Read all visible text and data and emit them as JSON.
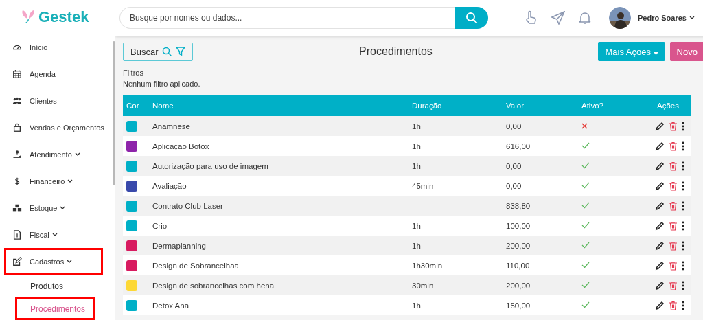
{
  "brand": {
    "name": "Gestek"
  },
  "sidebar": {
    "items": [
      {
        "label": "Início",
        "has_caret": false,
        "highlighted": false
      },
      {
        "label": "Agenda",
        "has_caret": false,
        "highlighted": false
      },
      {
        "label": "Clientes",
        "has_caret": false,
        "highlighted": false
      },
      {
        "label": "Vendas e Orçamentos",
        "has_caret": false,
        "highlighted": false
      },
      {
        "label": "Atendimento",
        "has_caret": true,
        "highlighted": false
      },
      {
        "label": "Financeiro",
        "has_caret": true,
        "highlighted": false
      },
      {
        "label": "Estoque",
        "has_caret": true,
        "highlighted": false
      },
      {
        "label": "Fiscal",
        "has_caret": true,
        "highlighted": false
      },
      {
        "label": "Cadastros",
        "has_caret": true,
        "highlighted": true,
        "children": [
          {
            "label": "Produtos",
            "selected": false,
            "highlighted": false
          },
          {
            "label": "Procedimentos",
            "selected": true,
            "highlighted": true
          }
        ]
      }
    ]
  },
  "header": {
    "search": {
      "placeholder": "Busque por nomes ou dados..."
    },
    "user": {
      "name": "Pedro Soares"
    }
  },
  "toolbar": {
    "search_button": "Buscar",
    "title": "Procedimentos",
    "more_button": "Mais Ações",
    "new_button": "Novo"
  },
  "filters": {
    "label": "Filtros",
    "status": "Nenhum filtro aplicado."
  },
  "table": {
    "columns": [
      "Cor",
      "Nome",
      "Duração",
      "Valor",
      "Ativo?",
      "Ações"
    ],
    "rows": [
      {
        "color": "#00b0c7",
        "name": "Anamnese",
        "duration": "1h",
        "value": "0,00",
        "active": false
      },
      {
        "color": "#8e24aa",
        "name": "Aplicação Botox",
        "duration": "1h",
        "value": "616,00",
        "active": true
      },
      {
        "color": "#00b0c7",
        "name": "Autorização para uso de imagem",
        "duration": "1h",
        "value": "0,00",
        "active": true
      },
      {
        "color": "#3949ab",
        "name": "Avaliação",
        "duration": "45min",
        "value": "0,00",
        "active": true
      },
      {
        "color": "#00b0c7",
        "name": "Contrato Club Laser",
        "value": "838,80",
        "active": true
      },
      {
        "color": "#00b0c7",
        "name": "Crio",
        "duration": "1h",
        "value": "100,00",
        "active": true
      },
      {
        "color": "#d81b60",
        "name": "Dermaplanning",
        "duration": "1h",
        "value": "200,00",
        "active": true
      },
      {
        "color": "#d81b60",
        "name": "Design de Sobrancelhaa",
        "duration": "1h30min",
        "value": "110,00",
        "active": true
      },
      {
        "color": "#fdd835",
        "name": "Design de sobrancelhas com hena",
        "duration": "30min",
        "value": "200,00",
        "active": true
      },
      {
        "color": "#00b0c7",
        "name": "Detox Ana",
        "duration": "1h",
        "value": "150,00",
        "active": true
      }
    ]
  }
}
